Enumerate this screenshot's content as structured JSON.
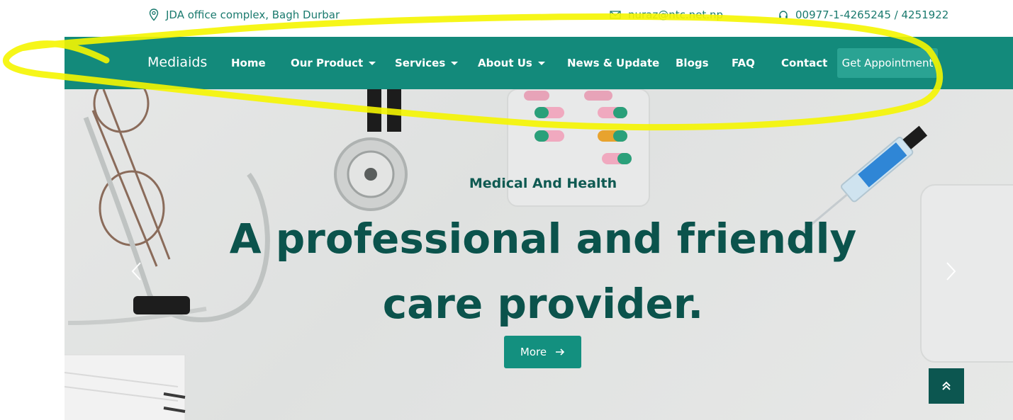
{
  "topbar": {
    "address": "JDA office complex, Bagh Durbar",
    "email": "nuraz@ntc.net.np",
    "phone": "00977-1-4265245 / 4251922",
    "address_icon": "map-pin-icon",
    "email_icon": "envelope-icon",
    "phone_icon": "headset-icon"
  },
  "nav": {
    "brand": "Mediaids",
    "items": [
      {
        "label": "Home",
        "dropdown": false
      },
      {
        "label": "Our Product",
        "dropdown": true
      },
      {
        "label": "Services",
        "dropdown": true
      },
      {
        "label": "About Us",
        "dropdown": true
      },
      {
        "label": "News & Update",
        "dropdown": false
      },
      {
        "label": "Blogs",
        "dropdown": false
      },
      {
        "label": "FAQ",
        "dropdown": false
      },
      {
        "label": "Contact",
        "dropdown": false
      }
    ],
    "cta": "Get Appointment"
  },
  "hero": {
    "subtitle": "Medical And Health",
    "headline": "A professional and friendly care provider.",
    "button": "More",
    "button_icon": "arrow-right-icon"
  },
  "colors": {
    "nav_bg": "#138a7b",
    "accent": "#13907f",
    "headline": "#0b534c",
    "highlight_annotation": "#f5f500"
  }
}
